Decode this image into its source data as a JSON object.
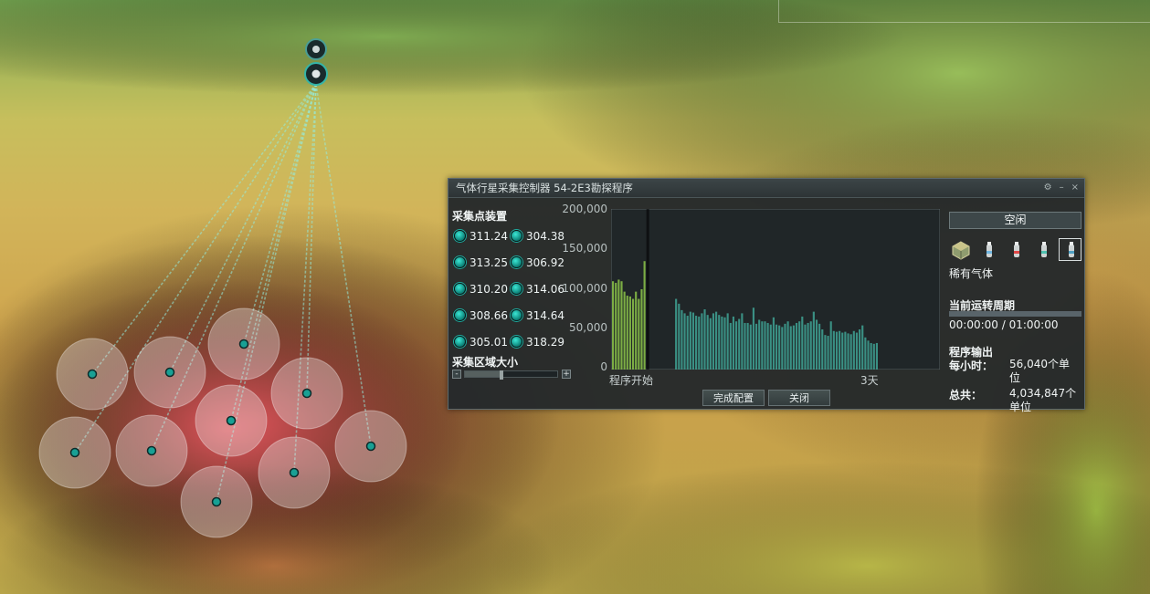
{
  "window": {
    "title": "气体行星采集控制器 54-2E3勘探程序",
    "controls": [
      "⚙",
      "–",
      "×"
    ]
  },
  "nodes": {
    "section_title": "采集点装置",
    "values": [
      "311.24",
      "304.38",
      "313.25",
      "306.92",
      "310.20",
      "314.06",
      "308.66",
      "314.64",
      "305.01",
      "318.29"
    ]
  },
  "area": {
    "section_title": "采集区域大小",
    "minus": "-",
    "plus": "+",
    "level": 0.4
  },
  "chart_data": {
    "type": "bar",
    "y_ticks": [
      "200,000",
      "150,000",
      "100,000",
      "50,000",
      "0"
    ],
    "ylim": [
      0,
      200000
    ],
    "x_start_label": "程序开始",
    "x_end_label": "3天",
    "highlight_color": "#8cc64a",
    "bar_color": "#3fa394",
    "values": [
      110000,
      108000,
      112000,
      110000,
      97000,
      92000,
      91000,
      88000,
      97000,
      88000,
      100000,
      135000,
      0,
      0,
      0,
      0,
      0,
      0,
      0,
      0,
      0,
      0,
      88000,
      82000,
      74000,
      70000,
      67000,
      72000,
      71000,
      67000,
      66000,
      70000,
      75000,
      68000,
      64000,
      70000,
      72000,
      68000,
      66000,
      65000,
      70000,
      58000,
      66000,
      60000,
      63000,
      70000,
      58000,
      58000,
      56000,
      77000,
      57000,
      62000,
      60000,
      60000,
      58000,
      56000,
      65000,
      56000,
      55000,
      53000,
      57000,
      60000,
      54000,
      55000,
      58000,
      60000,
      66000,
      56000,
      58000,
      60000,
      72000,
      62000,
      57000,
      50000,
      43000,
      42000,
      60000,
      48000,
      47000,
      48000,
      46000,
      47000,
      45000,
      44000,
      48000,
      46000,
      50000,
      55000,
      40000,
      36000,
      33000,
      32000,
      33000
    ]
  },
  "buttons": {
    "confirm": "完成配置",
    "close": "关闭"
  },
  "status": {
    "label": "空闲",
    "resource_name": "稀有气体",
    "cycle_title": "当前运转周期",
    "cycle_time": "00:00:00 / 01:00:00",
    "cycle_progress": 0,
    "output_title": "程序输出",
    "per_hour_label": "每小时：",
    "per_hour_value": "56,040个单位",
    "total_label": "总共：",
    "total_value": "4,034,847个单位"
  },
  "icons": [
    "resource-cube-icon",
    "gas-canister-1-icon",
    "gas-canister-2-icon",
    "gas-canister-3-icon",
    "gas-canister-4-icon"
  ],
  "colors": {
    "heat_hot": "#e0585a",
    "heat_warm": "#cfa64f",
    "heat_cool": "#9ac258",
    "node_teal": "#1fa99d"
  }
}
